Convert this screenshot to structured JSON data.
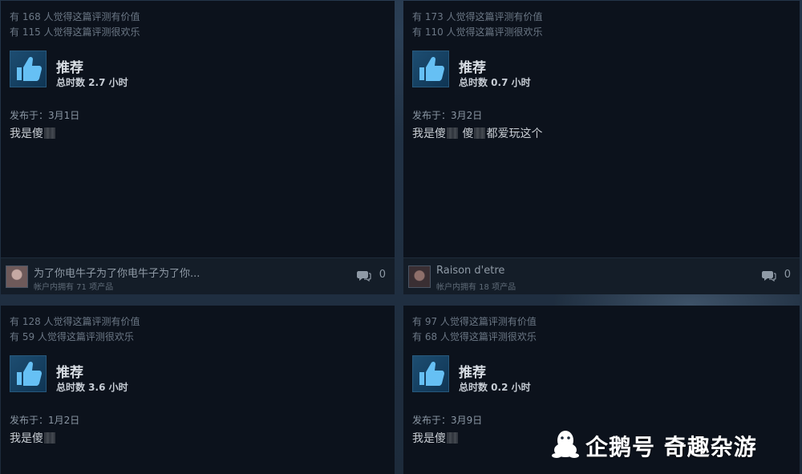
{
  "reviews": [
    {
      "helpful": "有 168 人觉得这篇评测有价值",
      "funny": "有 115 人觉得这篇评测很欢乐",
      "recommend": "推荐",
      "hours": "总时数 2.7 小时",
      "posted": "发布于：3月1日",
      "text_parts": [
        "我是傻",
        ""
      ],
      "user": "为了你电牛子为了你电牛子为了你...",
      "products": "帐户内拥有 71 项产品",
      "comments": "0"
    },
    {
      "helpful": "有 173 人觉得这篇评测有价值",
      "funny": "有 110 人觉得这篇评测很欢乐",
      "recommend": "推荐",
      "hours": "总时数 0.7 小时",
      "posted": "发布于：3月2日",
      "text_parts": [
        "我是傻",
        " 傻",
        "都爱玩这个"
      ],
      "user": "Raison d'etre",
      "products": "帐户内拥有 18 项产品",
      "comments": "0"
    },
    {
      "helpful": "有 128 人觉得这篇评测有价值",
      "funny": "有 59 人觉得这篇评测很欢乐",
      "recommend": "推荐",
      "hours": "总时数 3.6 小时",
      "posted": "发布于：1月2日",
      "text_parts": [
        "我是傻",
        ""
      ]
    },
    {
      "helpful": "有 97 人觉得这篇评测有价值",
      "funny": "有 68 人觉得这篇评测很欢乐",
      "recommend": "推荐",
      "hours": "总时数 0.2 小时",
      "posted": "发布于：3月9日",
      "text_parts": [
        "我是傻",
        ""
      ]
    }
  ],
  "watermark": {
    "text": "企鹅号 奇趣杂游",
    "icon": "penguin-icon"
  },
  "icons": {
    "thumb": "thumbs-up-icon",
    "comment": "comment-bubble-icon"
  },
  "colors": {
    "card_bg": "#0c121c",
    "page_bg": "#1b2838",
    "thumb_blue": "#66c0f4"
  }
}
